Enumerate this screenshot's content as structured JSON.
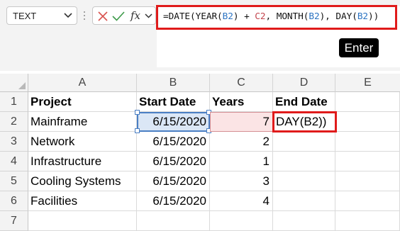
{
  "name_box": {
    "value": "TEXT"
  },
  "formula_bar": {
    "fx_label": "fx",
    "formula": [
      {
        "t": "=DATE(YEAR(",
        "k": "plain"
      },
      {
        "t": "B2",
        "k": "b2"
      },
      {
        "t": ") + ",
        "k": "plain"
      },
      {
        "t": "C2",
        "k": "c2"
      },
      {
        "t": ", MONTH(",
        "k": "plain"
      },
      {
        "t": "B2",
        "k": "b2"
      },
      {
        "t": "), DAY(",
        "k": "plain"
      },
      {
        "t": "B2",
        "k": "b2"
      },
      {
        "t": "))",
        "k": "plain"
      }
    ]
  },
  "enter_key_badge": "Enter",
  "columns": [
    "A",
    "B",
    "C",
    "D",
    "E"
  ],
  "rows": [
    "1",
    "2",
    "3",
    "4",
    "5",
    "6",
    "7"
  ],
  "headers": {
    "project": "Project",
    "start_date": "Start Date",
    "years": "Years",
    "end_date": "End Date"
  },
  "data_rows": [
    {
      "project": "Mainframe",
      "start_date": "6/15/2020",
      "years": "7",
      "end_date": "DAY(B2))"
    },
    {
      "project": "Network",
      "start_date": "6/15/2020",
      "years": "2",
      "end_date": ""
    },
    {
      "project": "Infrastructure",
      "start_date": "6/15/2020",
      "years": "1",
      "end_date": ""
    },
    {
      "project": "Cooling Systems",
      "start_date": "6/15/2020",
      "years": "3",
      "end_date": ""
    },
    {
      "project": "Facilities",
      "start_date": "6/15/2020",
      "years": "4",
      "end_date": ""
    }
  ],
  "colors": {
    "highlight_border": "#e01b1b",
    "ref_b2": "#2b73c2",
    "ref_c2": "#c4464f"
  }
}
